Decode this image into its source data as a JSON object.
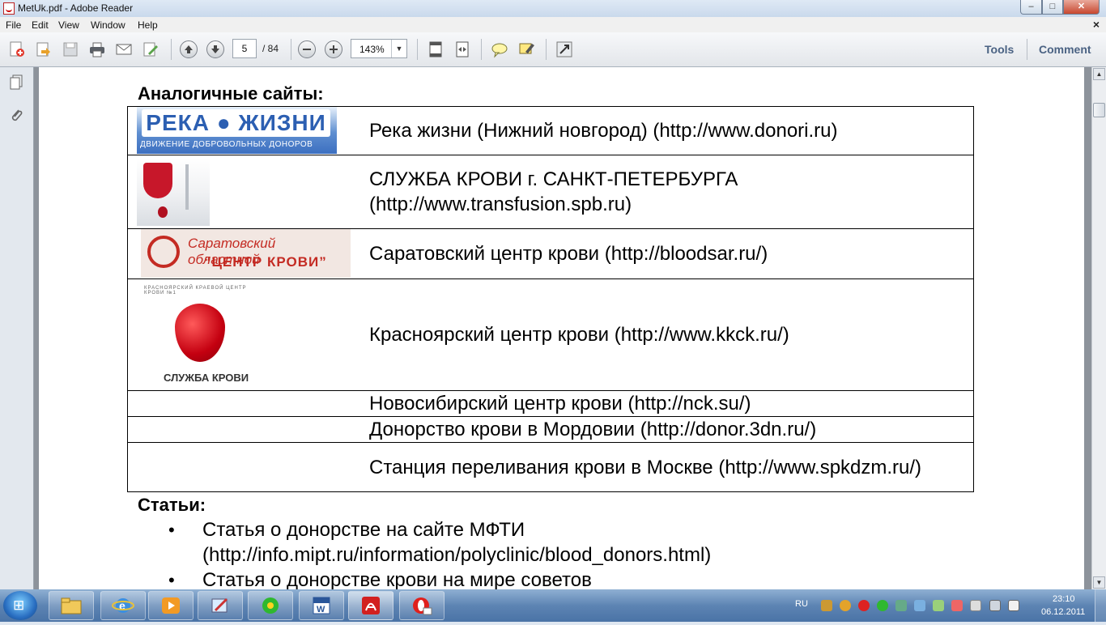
{
  "window": {
    "title": "MetUk.pdf - Adobe Reader",
    "minimize": "–",
    "maximize": "□",
    "close": "✕"
  },
  "menu": {
    "items": [
      "File",
      "Edit",
      "View",
      "Window",
      "Help"
    ],
    "close": "×"
  },
  "toolbar": {
    "page_current": "5",
    "page_total": "/ 84",
    "zoom": "143%",
    "tools_label": "Tools",
    "comment_label": "Comment"
  },
  "document": {
    "similar_sites_heading": "Аналогичные сайты:",
    "logos": {
      "reka_title": "РЕКА ● ЖИЗНИ",
      "reka_subtitle": "ДВИЖЕНИЕ ДОБРОВОЛЬНЫХ ДОНОРОВ",
      "saratov_line1": "Саратовский областной",
      "saratov_line2": "“ЦЕНТР КРОВИ”",
      "krasnoyarsk_arc": "КРАСНОЯРСКИЙ КРАЕВОЙ ЦЕНТР КРОВИ №1",
      "krasnoyarsk_caption": "СЛУЖБА КРОВИ"
    },
    "sites": [
      {
        "text": "Река жизни (Нижний новгород) (http://www.donori.ru)"
      },
      {
        "text": "СЛУЖБА КРОВИ г. САНКТ-ПЕТЕРБУРГА (http://www.transfusion.spb.ru)"
      },
      {
        "text": "Саратовский центр крови (http://bloodsar.ru/)"
      },
      {
        "text": "Красноярский центр крови (http://www.kkck.ru/)"
      },
      {
        "text": "Новосибирский центр крови (http://nck.su/)"
      },
      {
        "text": "Донорство крови в Мордовии (http://donor.3dn.ru/)"
      },
      {
        "text": "Станция переливания крови в Москве (http://www.spkdzm.ru/)"
      }
    ],
    "articles_heading": "Статьи:",
    "articles": [
      "Статья о донорстве на сайте МФТИ (http://info.mipt.ru/information/polyclinic/blood_donors.html)",
      "Статья о донорстве крови на мире советов"
    ]
  },
  "taskbar": {
    "language": "RU",
    "time": "23:10",
    "date": "06.12.2011",
    "apps": [
      "explorer",
      "internet-explorer",
      "media-player",
      "paint",
      "icq",
      "word",
      "adobe-reader",
      "opera-mail"
    ]
  },
  "colors": {
    "accent": "#4a6283",
    "title_bar": "#c9d9ec",
    "taskbar": "#4a73a6",
    "logo_red": "#c42b23"
  }
}
